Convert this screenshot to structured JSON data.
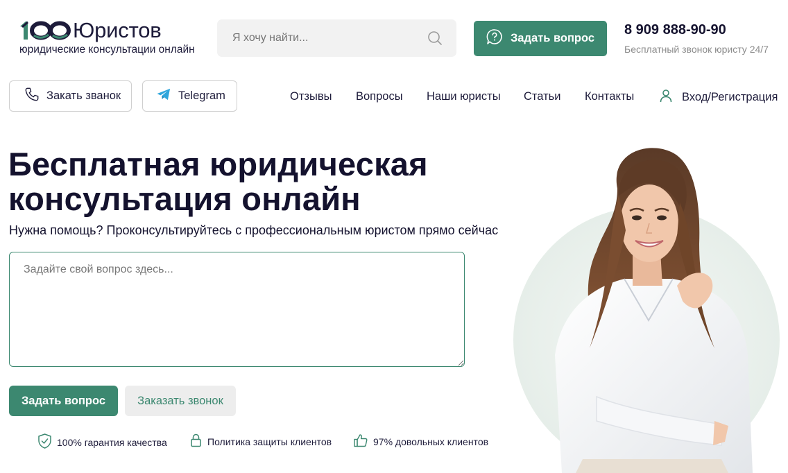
{
  "brand": {
    "logo_number": "100",
    "logo_word": "Юристов",
    "tagline": "юридические консультации онлайн"
  },
  "search": {
    "placeholder": "Я хочу найти...",
    "icon": "search-icon"
  },
  "header": {
    "ask_button": "Задать вопрос",
    "phone": "8 909 888-90-90",
    "phone_note": "Бесплатный звонок юристу 24/7"
  },
  "quick_buttons": {
    "call": "Закать званок",
    "telegram": "Telegram"
  },
  "nav": {
    "items": [
      "Отзывы",
      "Вопросы",
      "Наши юристы",
      "Статьи",
      "Контакты"
    ],
    "login": "Вход",
    "register": "Регистрация"
  },
  "hero": {
    "title_line1": "Бесплатная юридическая",
    "title_line2": "консультация онлайн",
    "subtitle": "Нужна помощь? Проконсультируйтесь с профессиональным юристом прямо сейчас",
    "question_placeholder": "Задайте свой вопрос здесь...",
    "primary_button": "Задать вопрос",
    "secondary_button": "Заказать звонок"
  },
  "badges": [
    {
      "icon": "shield-check-icon",
      "text": "100% гарантия качества"
    },
    {
      "icon": "lock-icon",
      "text": "Политика защиты клиентов"
    },
    {
      "icon": "thumbs-up-icon",
      "text": "97% довольных клиентов"
    }
  ],
  "colors": {
    "accent": "#3c8870",
    "text_dark": "#14122e",
    "muted": "#8b8b8b",
    "input_bg": "#f2f2f2"
  }
}
